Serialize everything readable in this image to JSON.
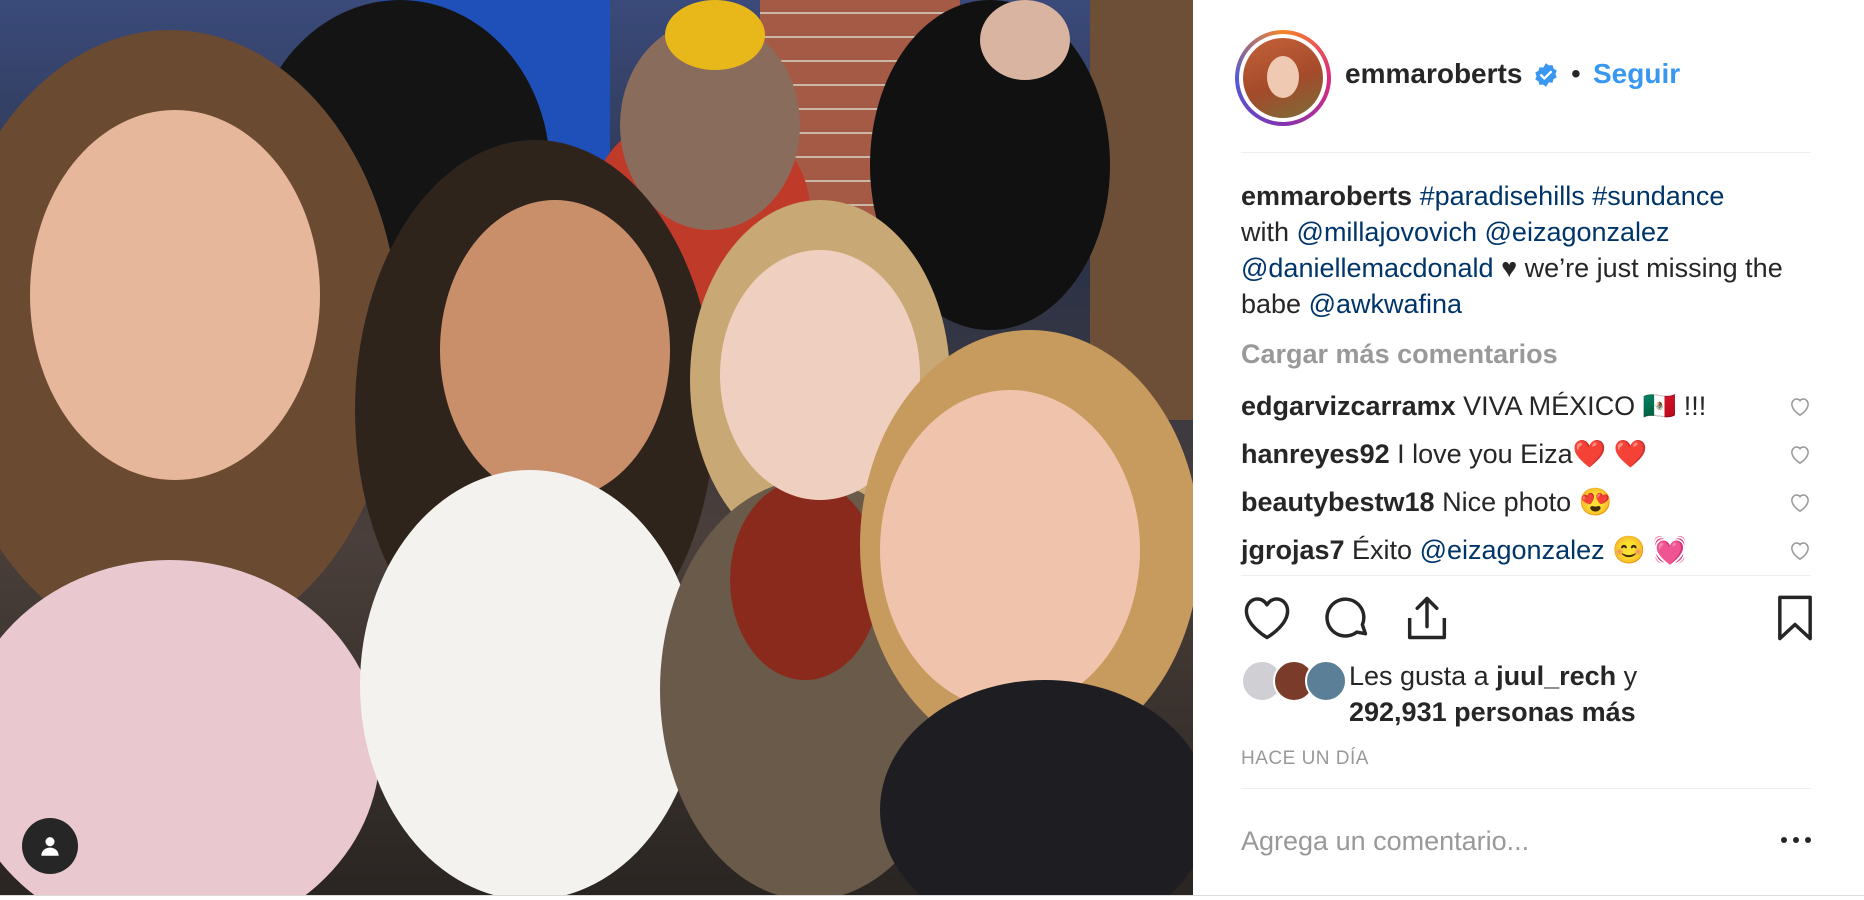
{
  "post": {
    "author": "emmaroberts",
    "follow_label": "Seguir",
    "separator": "•",
    "caption": {
      "username": "emmaroberts",
      "hashtag1": "#paradisehills",
      "hashtag2": "#sundance",
      "word_with": "with",
      "mention1": "@millajovovich",
      "mention2": "@eizagonzalez",
      "mention3": "@daniellemacdonald",
      "text_mid": " ♥ we’re just missing the babe ",
      "mention4": "@awkwafina"
    },
    "load_more_label": "Cargar más comentarios",
    "comments": [
      {
        "username": "edgarvizcarramx",
        "text": " VIVA MÉXICO 🇲🇽 !!!"
      },
      {
        "username": "hanreyes92",
        "text": " I love you Eiza❤️ ❤️"
      },
      {
        "username": "beautybestw18",
        "text": " Nice photo 😍"
      },
      {
        "username": "jgrojas7",
        "text_before": " Éxito ",
        "mention": "@eizagonzalez",
        "text_after": " 😊 💓"
      }
    ],
    "likes": {
      "prefix": "Les gusta a ",
      "user": "juul_rech",
      "suffix": " y",
      "count_text": "292,931 personas más"
    },
    "timestamp": "HACE UN DÍA",
    "comment_placeholder": "Agrega un comentario..."
  },
  "colors": {
    "link_blue": "#003569",
    "follow_blue": "#3897f0",
    "muted_gray": "#999999",
    "text_dark": "#262626",
    "verified_blue": "#3897f0"
  },
  "icons": [
    "user-tag-icon",
    "verified-badge-icon",
    "heart-icon",
    "comment-icon",
    "share-icon",
    "bookmark-icon",
    "more-options-icon"
  ]
}
